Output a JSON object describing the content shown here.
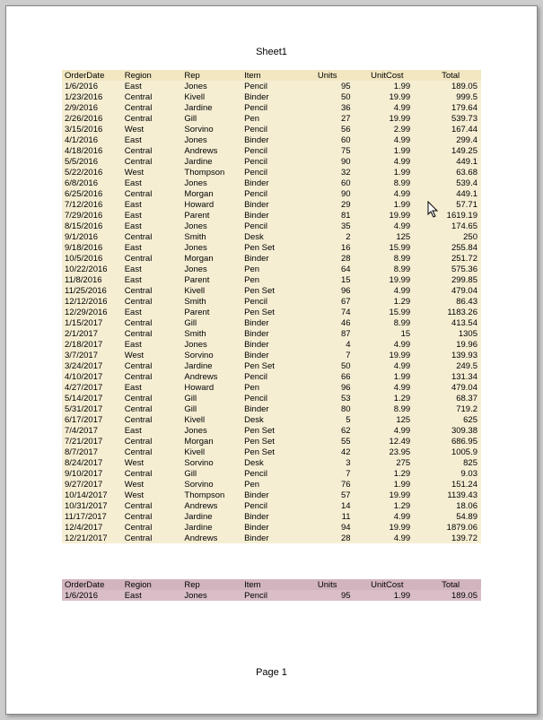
{
  "sheet_title": "Sheet1",
  "page_footer": "Page 1",
  "headers": {
    "orderdate": "OrderDate",
    "region": "Region",
    "rep": "Rep",
    "item": "Item",
    "units": "Units",
    "unitcost": "UnitCost",
    "total": "Total"
  },
  "rows": [
    {
      "date": "1/6/2016",
      "region": "East",
      "rep": "Jones",
      "item": "Pencil",
      "units": "95",
      "unitcost": "1.99",
      "total": "189.05"
    },
    {
      "date": "1/23/2016",
      "region": "Central",
      "rep": "Kivell",
      "item": "Binder",
      "units": "50",
      "unitcost": "19.99",
      "total": "999.5"
    },
    {
      "date": "2/9/2016",
      "region": "Central",
      "rep": "Jardine",
      "item": "Pencil",
      "units": "36",
      "unitcost": "4.99",
      "total": "179.64"
    },
    {
      "date": "2/26/2016",
      "region": "Central",
      "rep": "Gill",
      "item": "Pen",
      "units": "27",
      "unitcost": "19.99",
      "total": "539.73"
    },
    {
      "date": "3/15/2016",
      "region": "West",
      "rep": "Sorvino",
      "item": "Pencil",
      "units": "56",
      "unitcost": "2.99",
      "total": "167.44"
    },
    {
      "date": "4/1/2016",
      "region": "East",
      "rep": "Jones",
      "item": "Binder",
      "units": "60",
      "unitcost": "4.99",
      "total": "299.4"
    },
    {
      "date": "4/18/2016",
      "region": "Central",
      "rep": "Andrews",
      "item": "Pencil",
      "units": "75",
      "unitcost": "1.99",
      "total": "149.25"
    },
    {
      "date": "5/5/2016",
      "region": "Central",
      "rep": "Jardine",
      "item": "Pencil",
      "units": "90",
      "unitcost": "4.99",
      "total": "449.1"
    },
    {
      "date": "5/22/2016",
      "region": "West",
      "rep": "Thompson",
      "item": "Pencil",
      "units": "32",
      "unitcost": "1.99",
      "total": "63.68"
    },
    {
      "date": "6/8/2016",
      "region": "East",
      "rep": "Jones",
      "item": "Binder",
      "units": "60",
      "unitcost": "8.99",
      "total": "539.4"
    },
    {
      "date": "6/25/2016",
      "region": "Central",
      "rep": "Morgan",
      "item": "Pencil",
      "units": "90",
      "unitcost": "4.99",
      "total": "449.1"
    },
    {
      "date": "7/12/2016",
      "region": "East",
      "rep": "Howard",
      "item": "Binder",
      "units": "29",
      "unitcost": "1.99",
      "total": "57.71"
    },
    {
      "date": "7/29/2016",
      "region": "East",
      "rep": "Parent",
      "item": "Binder",
      "units": "81",
      "unitcost": "19.99",
      "total": "1619.19"
    },
    {
      "date": "8/15/2016",
      "region": "East",
      "rep": "Jones",
      "item": "Pencil",
      "units": "35",
      "unitcost": "4.99",
      "total": "174.65"
    },
    {
      "date": "9/1/2016",
      "region": "Central",
      "rep": "Smith",
      "item": "Desk",
      "units": "2",
      "unitcost": "125",
      "total": "250"
    },
    {
      "date": "9/18/2016",
      "region": "East",
      "rep": "Jones",
      "item": "Pen Set",
      "units": "16",
      "unitcost": "15.99",
      "total": "255.84"
    },
    {
      "date": "10/5/2016",
      "region": "Central",
      "rep": "Morgan",
      "item": "Binder",
      "units": "28",
      "unitcost": "8.99",
      "total": "251.72"
    },
    {
      "date": "10/22/2016",
      "region": "East",
      "rep": "Jones",
      "item": "Pen",
      "units": "64",
      "unitcost": "8.99",
      "total": "575.36"
    },
    {
      "date": "11/8/2016",
      "region": "East",
      "rep": "Parent",
      "item": "Pen",
      "units": "15",
      "unitcost": "19.99",
      "total": "299.85"
    },
    {
      "date": "11/25/2016",
      "region": "Central",
      "rep": "Kivell",
      "item": "Pen Set",
      "units": "96",
      "unitcost": "4.99",
      "total": "479.04"
    },
    {
      "date": "12/12/2016",
      "region": "Central",
      "rep": "Smith",
      "item": "Pencil",
      "units": "67",
      "unitcost": "1.29",
      "total": "86.43"
    },
    {
      "date": "12/29/2016",
      "region": "East",
      "rep": "Parent",
      "item": "Pen Set",
      "units": "74",
      "unitcost": "15.99",
      "total": "1183.26"
    },
    {
      "date": "1/15/2017",
      "region": "Central",
      "rep": "Gill",
      "item": "Binder",
      "units": "46",
      "unitcost": "8.99",
      "total": "413.54"
    },
    {
      "date": "2/1/2017",
      "region": "Central",
      "rep": "Smith",
      "item": "Binder",
      "units": "87",
      "unitcost": "15",
      "total": "1305"
    },
    {
      "date": "2/18/2017",
      "region": "East",
      "rep": "Jones",
      "item": "Binder",
      "units": "4",
      "unitcost": "4.99",
      "total": "19.96"
    },
    {
      "date": "3/7/2017",
      "region": "West",
      "rep": "Sorvino",
      "item": "Binder",
      "units": "7",
      "unitcost": "19.99",
      "total": "139.93"
    },
    {
      "date": "3/24/2017",
      "region": "Central",
      "rep": "Jardine",
      "item": "Pen Set",
      "units": "50",
      "unitcost": "4.99",
      "total": "249.5"
    },
    {
      "date": "4/10/2017",
      "region": "Central",
      "rep": "Andrews",
      "item": "Pencil",
      "units": "66",
      "unitcost": "1.99",
      "total": "131.34"
    },
    {
      "date": "4/27/2017",
      "region": "East",
      "rep": "Howard",
      "item": "Pen",
      "units": "96",
      "unitcost": "4.99",
      "total": "479.04"
    },
    {
      "date": "5/14/2017",
      "region": "Central",
      "rep": "Gill",
      "item": "Pencil",
      "units": "53",
      "unitcost": "1.29",
      "total": "68.37"
    },
    {
      "date": "5/31/2017",
      "region": "Central",
      "rep": "Gill",
      "item": "Binder",
      "units": "80",
      "unitcost": "8.99",
      "total": "719.2"
    },
    {
      "date": "6/17/2017",
      "region": "Central",
      "rep": "Kivell",
      "item": "Desk",
      "units": "5",
      "unitcost": "125",
      "total": "625"
    },
    {
      "date": "7/4/2017",
      "region": "East",
      "rep": "Jones",
      "item": "Pen Set",
      "units": "62",
      "unitcost": "4.99",
      "total": "309.38"
    },
    {
      "date": "7/21/2017",
      "region": "Central",
      "rep": "Morgan",
      "item": "Pen Set",
      "units": "55",
      "unitcost": "12.49",
      "total": "686.95"
    },
    {
      "date": "8/7/2017",
      "region": "Central",
      "rep": "Kivell",
      "item": "Pen Set",
      "units": "42",
      "unitcost": "23.95",
      "total": "1005.9"
    },
    {
      "date": "8/24/2017",
      "region": "West",
      "rep": "Sorvino",
      "item": "Desk",
      "units": "3",
      "unitcost": "275",
      "total": "825"
    },
    {
      "date": "9/10/2017",
      "region": "Central",
      "rep": "Gill",
      "item": "Pencil",
      "units": "7",
      "unitcost": "1.29",
      "total": "9.03"
    },
    {
      "date": "9/27/2017",
      "region": "West",
      "rep": "Sorvino",
      "item": "Pen",
      "units": "76",
      "unitcost": "1.99",
      "total": "151.24"
    },
    {
      "date": "10/14/2017",
      "region": "West",
      "rep": "Thompson",
      "item": "Binder",
      "units": "57",
      "unitcost": "19.99",
      "total": "1139.43"
    },
    {
      "date": "10/31/2017",
      "region": "Central",
      "rep": "Andrews",
      "item": "Pencil",
      "units": "14",
      "unitcost": "1.29",
      "total": "18.06"
    },
    {
      "date": "11/17/2017",
      "region": "Central",
      "rep": "Jardine",
      "item": "Binder",
      "units": "11",
      "unitcost": "4.99",
      "total": "54.89"
    },
    {
      "date": "12/4/2017",
      "region": "Central",
      "rep": "Jardine",
      "item": "Binder",
      "units": "94",
      "unitcost": "19.99",
      "total": "1879.06"
    },
    {
      "date": "12/21/2017",
      "region": "Central",
      "rep": "Andrews",
      "item": "Binder",
      "units": "28",
      "unitcost": "4.99",
      "total": "139.72"
    }
  ],
  "summary_rows": [
    {
      "date": "1/6/2016",
      "region": "East",
      "rep": "Jones",
      "item": "Pencil",
      "units": "95",
      "unitcost": "1.99",
      "total": "189.05"
    }
  ]
}
